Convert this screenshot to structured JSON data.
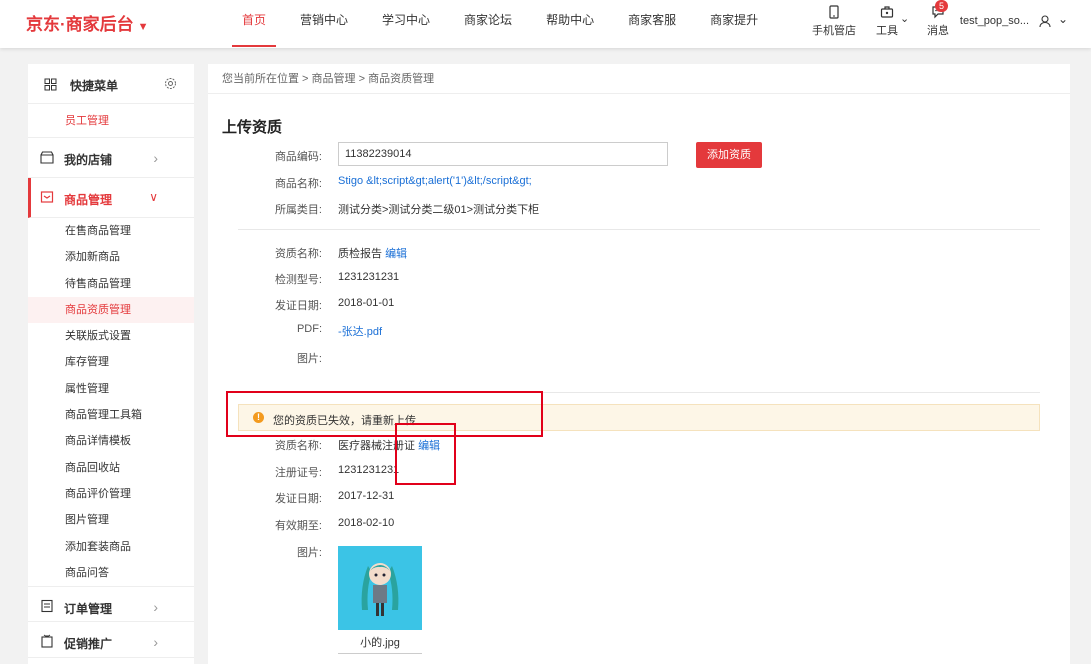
{
  "header": {
    "logo": "京东·商家后台",
    "nav": [
      "首页",
      "营销中心",
      "学习中心",
      "商家论坛",
      "帮助中心",
      "商家客服",
      "商家提升"
    ],
    "tools": {
      "mobile": "手机管店",
      "tool": "工具",
      "msg": "消息",
      "badge": "5"
    },
    "user": "test_pop_so..."
  },
  "sidebar": {
    "quick_title": "快捷菜单",
    "quick_sub": "员工管理",
    "groups": {
      "shop": "我的店铺",
      "goods": "商品管理",
      "order": "订单管理",
      "promo": "促销推广"
    },
    "items": [
      "在售商品管理",
      "添加新商品",
      "待售商品管理",
      "商品资质管理",
      "关联版式设置",
      "库存管理",
      "属性管理",
      "商品管理工具箱",
      "商品详情模板",
      "商品回收站",
      "商品评价管理",
      "图片管理",
      "添加套装商品",
      "商品问答"
    ]
  },
  "main": {
    "breadcrumb": "您当前所在位置 > 商品管理 > 商品资质管理",
    "title": "上传资质",
    "product": {
      "code_label": "商品编码:",
      "code_value": "11382239014",
      "add_button": "添加资质",
      "name_label": "商品名称:",
      "name_value": "Stigo &lt;script&gt;alert('1')&lt;/script&gt;",
      "cat_label": "所属类目:",
      "cat_value": "测试分类>测试分类二级01>测试分类下柜"
    },
    "q1": {
      "name_label": "资质名称:",
      "name_value": "质检报告",
      "edit": "编辑",
      "model_label": "检测型号:",
      "model_value": "1231231231",
      "date_label": "发证日期:",
      "date_value": "2018-01-01",
      "pdf_label": "PDF:",
      "pdf_value": "-张达.pdf",
      "img_label": "图片:"
    },
    "warning": "您的资质已失效，请重新上传",
    "q2": {
      "name_label": "资质名称:",
      "name_value": "医疗器械注册证",
      "edit": "编辑",
      "reg_label": "注册证号:",
      "reg_value": "1231231231",
      "date_label": "发证日期:",
      "date_value": "2017-12-31",
      "exp_label": "有效期至:",
      "exp_value": "2018-02-10",
      "img_label": "图片:",
      "img_caption": "小的.jpg"
    }
  },
  "colors": {
    "brand": "#e4393c",
    "link": "#1a6fd6",
    "annotation": "#e1001a"
  }
}
